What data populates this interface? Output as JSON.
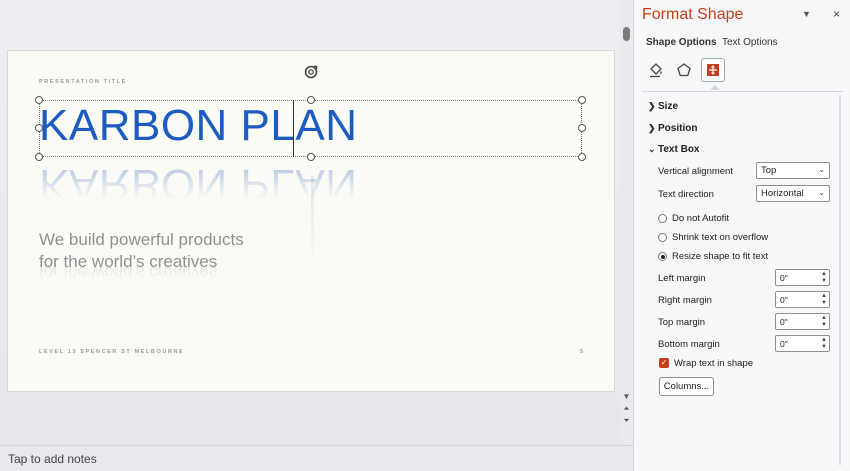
{
  "slide": {
    "presentation_title": "PRESENTATION TITLE",
    "main_title": "KARBON PLAN",
    "tagline_line1": "We build powerful products",
    "tagline_line2": "for the world’s creatives",
    "footer_left": "LEVEL 13 SPENCER ST MELBOURNE",
    "footer_right": "5"
  },
  "notes": {
    "placeholder": "Tap to add notes"
  },
  "pane": {
    "title": "Format Shape",
    "dropdown_icon": "chevron-down-icon",
    "close_label": "×",
    "tabs": [
      "Shape Options",
      "Text Options"
    ],
    "icons": [
      "fill-line-icon",
      "effects-pentagon-icon",
      "size-properties-icon"
    ],
    "sections": {
      "size": "Size",
      "position": "Position",
      "text_box": "Text Box"
    },
    "vertical_alignment": {
      "label": "Vertical alignment",
      "value": "Top"
    },
    "text_direction": {
      "label": "Text direction",
      "value": "Horizontal"
    },
    "autofit": {
      "options": [
        "Do not Autofit",
        "Shrink text on overflow",
        "Resize shape to fit text"
      ],
      "selected": "Resize shape to fit text"
    },
    "margins": {
      "left": {
        "label": "Left margin",
        "value": "0\""
      },
      "right": {
        "label": "Right margin",
        "value": "0\""
      },
      "top": {
        "label": "Top margin",
        "value": "0\""
      },
      "bottom": {
        "label": "Bottom margin",
        "value": "0\""
      }
    },
    "wrap_text": {
      "label": "Wrap text in shape",
      "checked": true
    },
    "columns_button": "Columns..."
  },
  "colors": {
    "accent": "#c43e1c",
    "title_blue": "#1c5bbf",
    "tagline_gray": "#8f9092"
  }
}
